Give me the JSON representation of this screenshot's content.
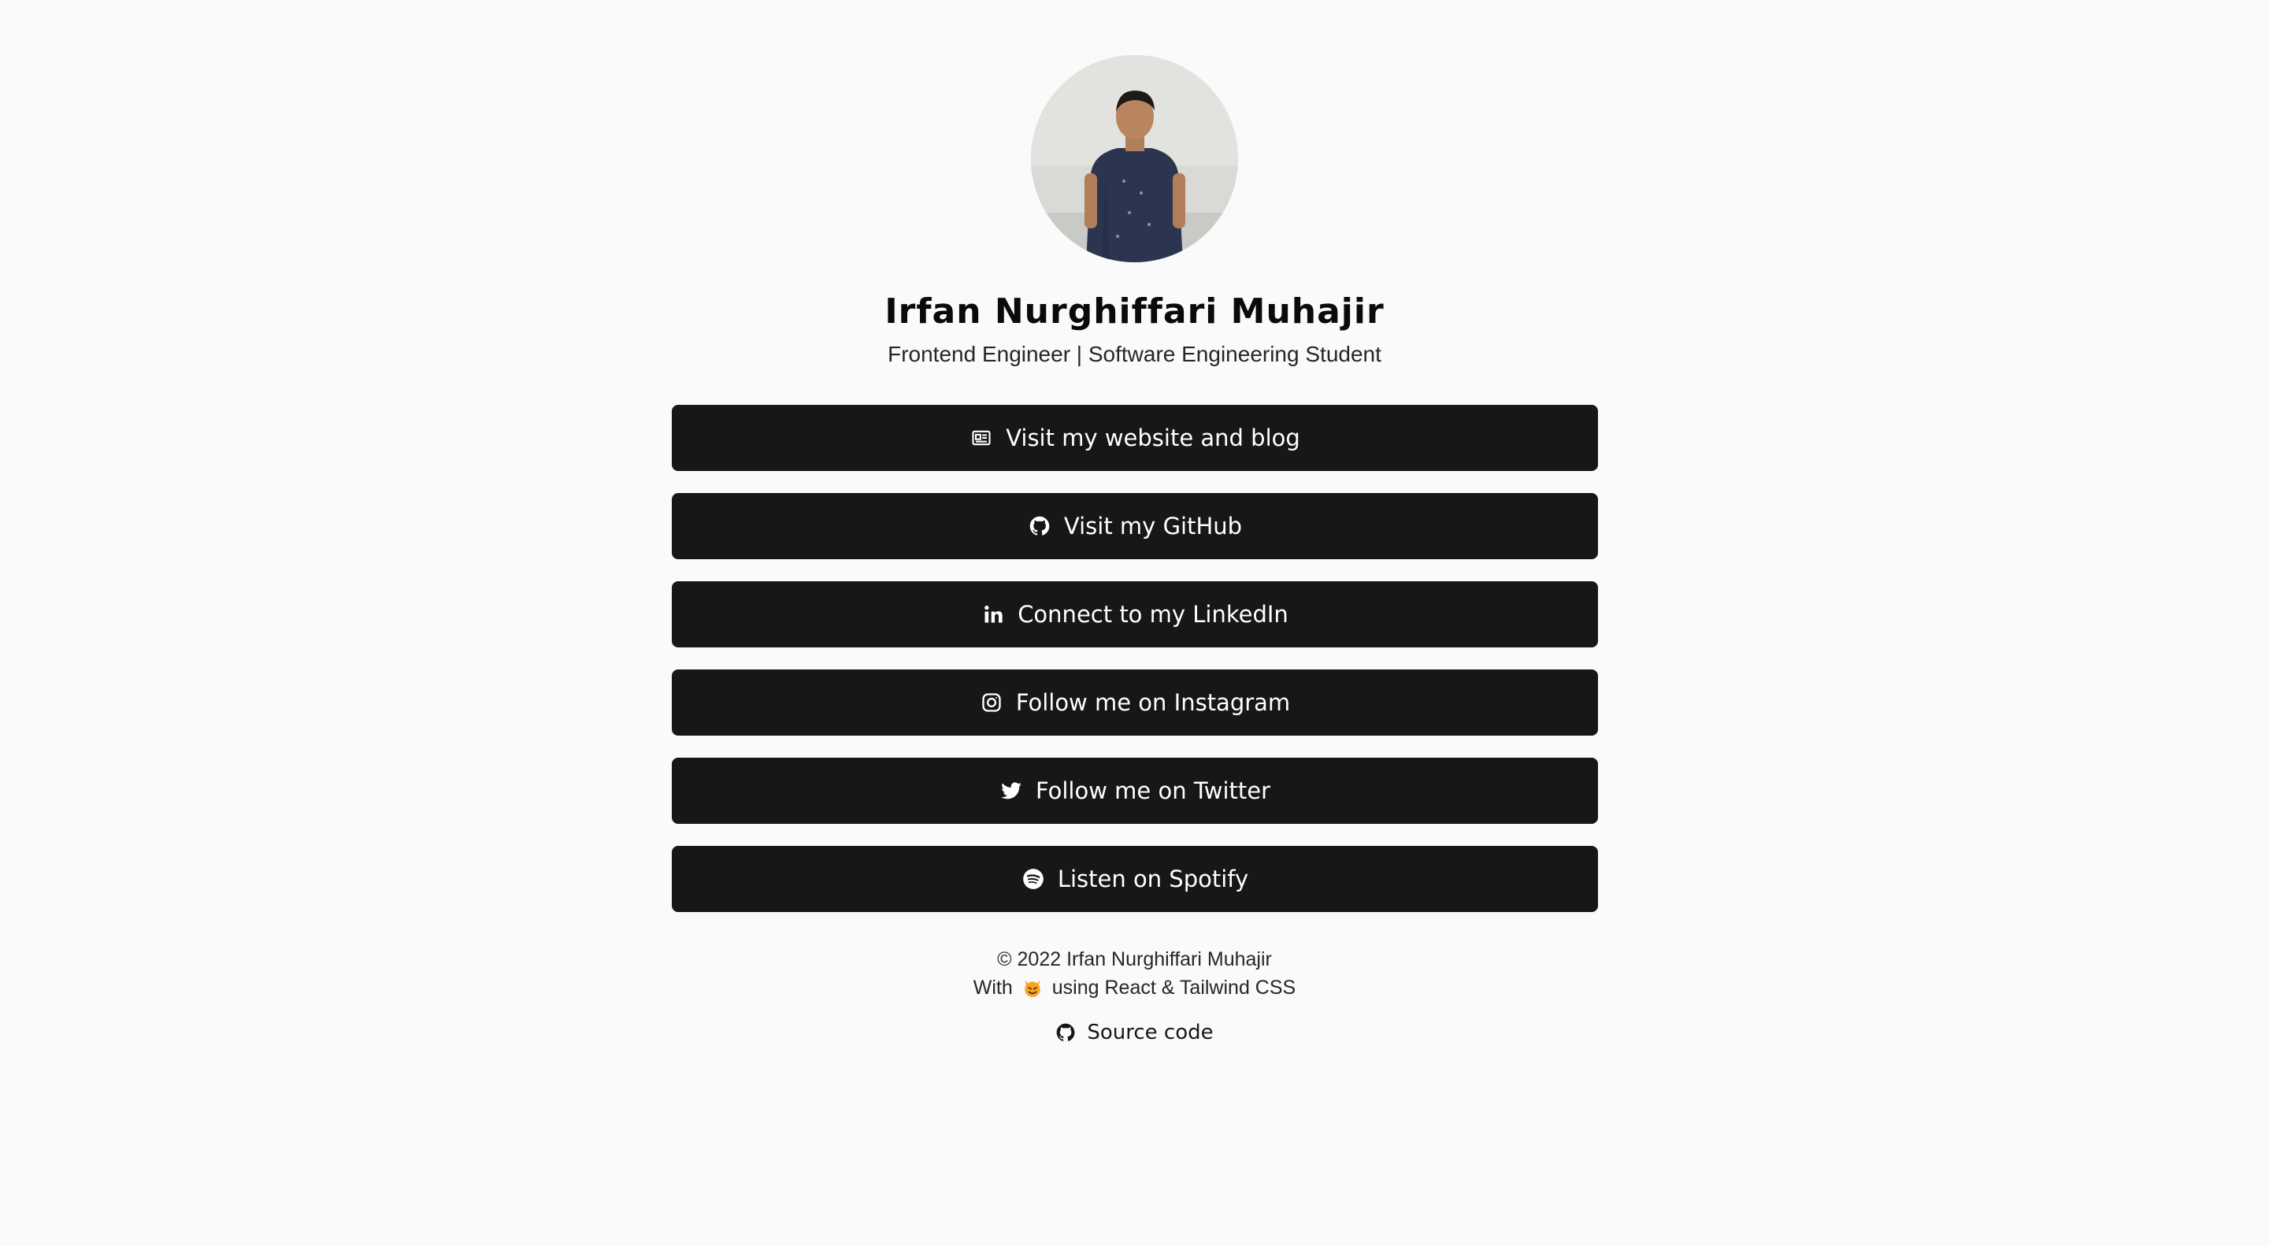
{
  "profile": {
    "name": "Irfan Nurghiffari Muhajir",
    "tagline": "Frontend Engineer | Software Engineering Student"
  },
  "links": [
    {
      "label": "Visit my website and blog",
      "icon": "newspaper-icon"
    },
    {
      "label": "Visit my GitHub",
      "icon": "github-icon"
    },
    {
      "label": "Connect to my LinkedIn",
      "icon": "linkedin-icon"
    },
    {
      "label": "Follow me on Instagram",
      "icon": "instagram-icon"
    },
    {
      "label": "Follow me on Twitter",
      "icon": "twitter-icon"
    },
    {
      "label": "Listen on Spotify",
      "icon": "spotify-icon"
    }
  ],
  "footer": {
    "copyright": "© 2022 Irfan Nurghiffari Muhajir",
    "with": "With",
    "using": "using React & Tailwind CSS",
    "source_label": "Source code"
  },
  "colors": {
    "background": "#fafafa",
    "button": "#171717",
    "button_text": "#ffffff"
  }
}
